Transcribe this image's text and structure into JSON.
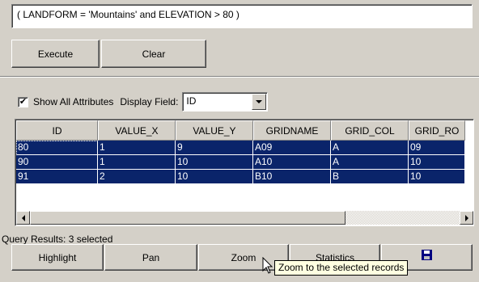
{
  "query": {
    "expression": "( LANDFORM = 'Mountains' and ELEVATION > 80 )",
    "execute_label": "Execute",
    "clear_label": "Clear"
  },
  "options": {
    "show_all_attributes_label": "Show All Attributes",
    "show_all_attributes_checked": true,
    "check_mark": "✔",
    "display_field_label": "Display Field:",
    "display_field_value": "ID"
  },
  "table": {
    "columns": [
      "ID",
      "VALUE_X",
      "VALUE_Y",
      "GRIDNAME",
      "GRID_COL",
      "GRID_RO"
    ],
    "rows": [
      [
        "80",
        "1",
        "9",
        "A09",
        "A",
        "09"
      ],
      [
        "90",
        "1",
        "10",
        "A10",
        "A",
        "10"
      ],
      [
        "91",
        "2",
        "10",
        "B10",
        "B",
        "10"
      ]
    ]
  },
  "status": {
    "text": "Query Results: 3 selected"
  },
  "buttons": {
    "highlight": "Highlight",
    "pan": "Pan",
    "zoom": "Zoom",
    "statistics": "Statistics",
    "save_icon": "floppy-disk-icon"
  },
  "tooltip": {
    "text": "Zoom to the selected records"
  }
}
